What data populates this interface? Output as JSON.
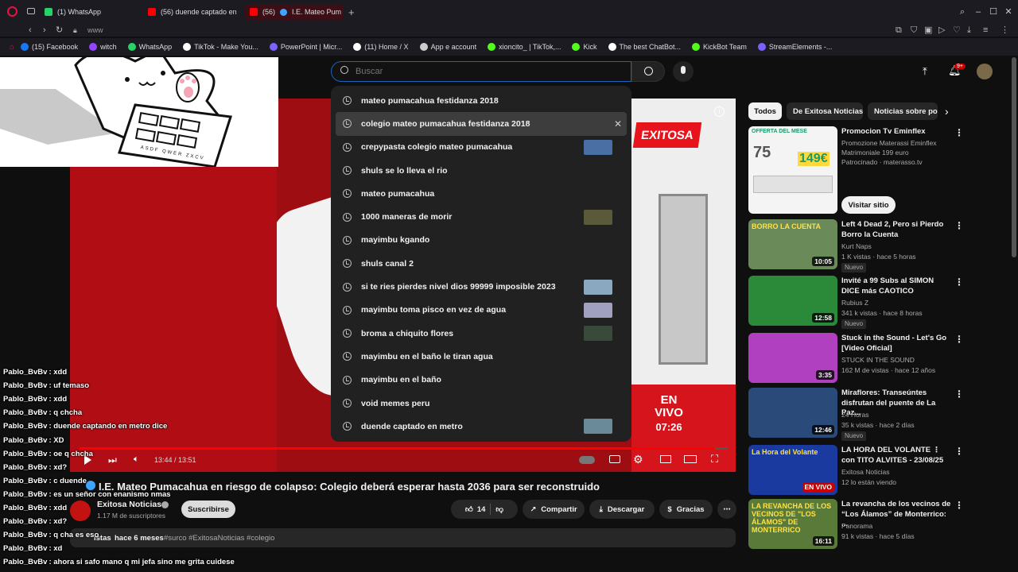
{
  "browser": {
    "tabs": [
      {
        "label": "(1) WhatsApp",
        "color": "#25d366"
      },
      {
        "label": "(56) duende captado en",
        "color": "#ff0000"
      },
      {
        "label": "(56)",
        "color": "#ff0000"
      }
    ],
    "active_tab_title": "I.E. Mateo Pum",
    "new_tab": "+",
    "address": "www",
    "bookmarks": [
      {
        "label": "(15) Facebook",
        "color": "#1877f2"
      },
      {
        "label": "witch",
        "color": "#9146ff"
      },
      {
        "label": "WhatsApp",
        "color": "#25d366"
      },
      {
        "label": "TikTok - Make You...",
        "color": "#ffffff"
      },
      {
        "label": "PowerPoint | Micr...",
        "color": "#7b61ff"
      },
      {
        "label": "(11) Home / X",
        "color": "#ffffff"
      },
      {
        "label": "App e account",
        "color": "#cccccc"
      },
      {
        "label": "xioncito_ | TikTok,...",
        "color": "#53fc18"
      },
      {
        "label": "Kick",
        "color": "#53fc18"
      },
      {
        "label": "The best ChatBot...",
        "color": "#ffffff"
      },
      {
        "label": "KickBot Team",
        "color": "#53fc18"
      },
      {
        "label": "StreamElements -...",
        "color": "#7b61ff"
      }
    ]
  },
  "header": {
    "search_placeholder": "Buscar",
    "notif_count": "9+"
  },
  "suggestions": [
    {
      "text": "mateo pumacahua festidanza 2018",
      "thumb": false
    },
    {
      "text": "colegio mateo pumacahua festidanza 2018",
      "thumb": false,
      "highlight": true,
      "remove": "✕"
    },
    {
      "text": "crepypasta colegio mateo pumacahua",
      "thumb": true,
      "tcolor": "#4a6fa5"
    },
    {
      "text": "shuls se lo lleva el rio",
      "thumb": false
    },
    {
      "text": "mateo pumacahua",
      "thumb": false
    },
    {
      "text": "1000 maneras de morir",
      "thumb": true,
      "tcolor": "#5a5a3a"
    },
    {
      "text": "mayimbu kgando",
      "thumb": false
    },
    {
      "text": "shuls canal 2",
      "thumb": false
    },
    {
      "text": "si te ries pierdes nivel dios 99999 imposible 2023",
      "thumb": true,
      "tcolor": "#8aa8c0"
    },
    {
      "text": "mayimbu toma pisco en vez de agua",
      "thumb": true,
      "tcolor": "#a0a0c0"
    },
    {
      "text": "broma a chiquito flores",
      "thumb": true,
      "tcolor": "#3a4a3a"
    },
    {
      "text": "mayimbu en el baño le tiran agua",
      "thumb": false
    },
    {
      "text": "mayimbu en el baño",
      "thumb": false
    },
    {
      "text": "void memes peru",
      "thumb": false
    },
    {
      "text": "duende captado en metro",
      "thumb": true,
      "tcolor": "#6a8a9a"
    }
  ],
  "video": {
    "logo": "EXITOSA",
    "live_line1": "EN",
    "live_line2": "VIVO",
    "clock": "07:26",
    "time": "13:44 / 13:51",
    "progress": 0.98
  },
  "cat_keys": "ASDF QWER ZXCV",
  "title": "I.E. Mateo Pumacahua en riesgo de colapso: Colegio deberá esperar hasta 2036 para ser reconstruido",
  "channel": {
    "name": "Exitosa Noticias",
    "subs": "1.17 M de suscriptores",
    "subscribe": "Suscribirse"
  },
  "actions": {
    "likes": "14",
    "share": "Compartir",
    "download": "Descargar",
    "thanks": "Gracias"
  },
  "desc": {
    "views": "istas",
    "ago": "hace 6 meses",
    "tags": "#surco #ExitosaNoticias #colegio"
  },
  "chat": [
    {
      "user": "Pablo_BvBv",
      "msg": ": xdd"
    },
    {
      "user": "Pablo_BvBv",
      "msg": ": uf temaso"
    },
    {
      "user": "Pablo_BvBv",
      "msg": ": xdd"
    },
    {
      "user": "Pablo_BvBv",
      "msg": ": q chcha"
    },
    {
      "user": "Pablo_BvBv",
      "msg": ": duende captando en metro dice"
    },
    {
      "user": "Pablo_BvBv",
      "msg": ": XD"
    },
    {
      "user": "Pablo_BvBv",
      "msg": ": oe q chcha"
    },
    {
      "user": "Pablo_BvBv",
      "msg": ": xd?"
    },
    {
      "user": "Pablo_BvBv",
      "msg": ": c duende"
    },
    {
      "user": "Pablo_BvBv",
      "msg": ": es un señor con enanismo nmas"
    },
    {
      "user": "Pablo_BvBv",
      "msg": ": xdd"
    },
    {
      "user": "Pablo_BvBv",
      "msg": ": xd?"
    },
    {
      "user": "Pablo_BvBv",
      "msg": ": q cha es eso"
    },
    {
      "user": "Pablo_BvBv",
      "msg": ": xd"
    },
    {
      "user": "Pablo_BvBv",
      "msg": ": ahora si safo mano q mi jefa sino me grita cuidese"
    }
  ],
  "chips": [
    "Todos",
    "De Exitosa Noticias",
    "Noticias sobre po"
  ],
  "recs": [
    {
      "title": "Promocion Tv Eminflex",
      "meta1": "Promozione Materassi Eminflex Matrimoniale 199 euro",
      "meta2": "Patrocinado · materasso.tv",
      "ad": true,
      "cta": "Visitar sitio",
      "tcolor": "#3aa88a",
      "ad_text": "OFFERTA DEL MESE",
      "ad_price": "149€",
      "ad_from": "75"
    },
    {
      "title": "Left 4 Dead 2, Pero si Pierdo Borro la Cuenta",
      "meta1": "Kurt Naps",
      "meta2": "1 K vistas · hace 5 horas",
      "badge": "Nuevo",
      "dur": "10:05",
      "tcolor": "#6a8a5a",
      "thumb_text": "BORRO LA CUENTA"
    },
    {
      "title": "Invité a 99 Subs al SIMON DICE más CAOTICO",
      "meta1": "Rubius Z",
      "meta2": "341 k vistas · hace 8 horas",
      "badge": "Nuevo",
      "dur": "12:58",
      "tcolor": "#2a8a3a"
    },
    {
      "title": "Stuck in the Sound - Let's Go [Video Oficial]",
      "meta1": "STUCK IN THE SOUND",
      "meta2": "162 M de vistas · hace 12 años",
      "dur": "3:35",
      "tcolor": "#b040c0"
    },
    {
      "title": "Miraflores: Transeúntes disfrutan del puente de La Paz...",
      "meta1": "24 Horas",
      "meta2": "35 k vistas · hace 2 días",
      "badge": "Nuevo",
      "dur": "12:46",
      "tcolor": "#2a4a7a"
    },
    {
      "title": "LA HORA DEL VOLANTE ⋮ con TITO ALVITES - 23/08/25",
      "meta1": "Exitosa Noticias",
      "meta2": "12 lo están viendo",
      "live": "EN VIVO",
      "tcolor": "#1a3aa0",
      "thumb_text": "La Hora del Volante"
    },
    {
      "title": "La revancha de los vecinos de “Los Álamos” de Monterrico: ...",
      "meta1": "Panorama",
      "meta2": "91 k vistas · hace 5 días",
      "dur": "16:11",
      "tcolor": "#5a7a3a",
      "thumb_text": "LA REVANCHA DE LOS VECINOS DE \"LOS ÁLAMOS\" DE MONTERRICO"
    }
  ]
}
